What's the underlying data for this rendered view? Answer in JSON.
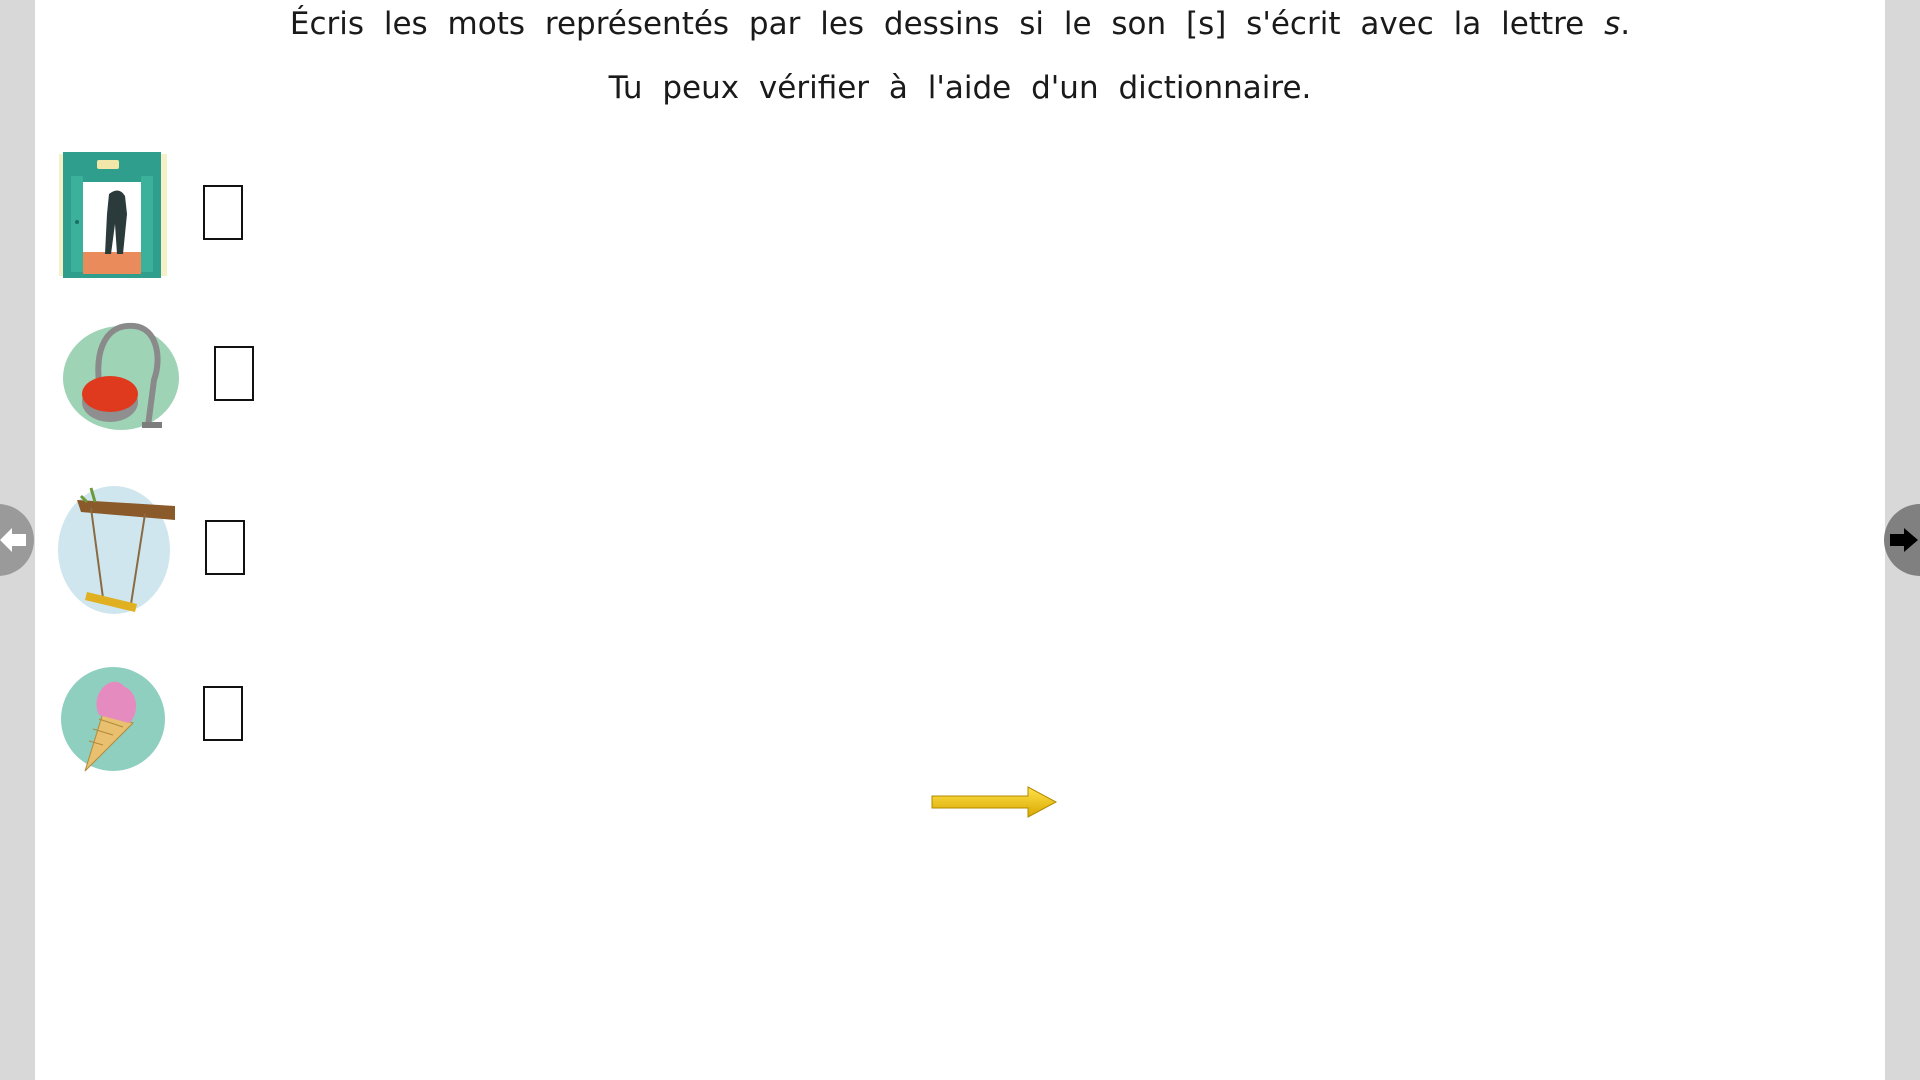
{
  "instructions": {
    "line1_before": "Écris les mots représentés par les dessins si le son [s] s'écrit avec la lettre ",
    "line1_letter": "s",
    "line1_after": ".",
    "line2": "Tu peux vérifier à l'aide d'un dictionnaire."
  },
  "exercise": {
    "items": [
      {
        "icon": "elevator-icon",
        "answer": ""
      },
      {
        "icon": "vacuum-cleaner-icon",
        "answer": ""
      },
      {
        "icon": "swing-icon",
        "answer": ""
      },
      {
        "icon": "ice-cream-icon",
        "answer": ""
      }
    ]
  },
  "navigation": {
    "prev_icon": "arrow-left-icon",
    "next_icon": "arrow-right-icon",
    "continue_icon": "yellow-arrow-icon"
  },
  "colors": {
    "elevator": "#2f9e8c",
    "vacuum_body": "#e03a1e",
    "ice_cream": "#e58bc0",
    "arrow": "#f2c500",
    "nav_button": "#9a9a9a"
  }
}
